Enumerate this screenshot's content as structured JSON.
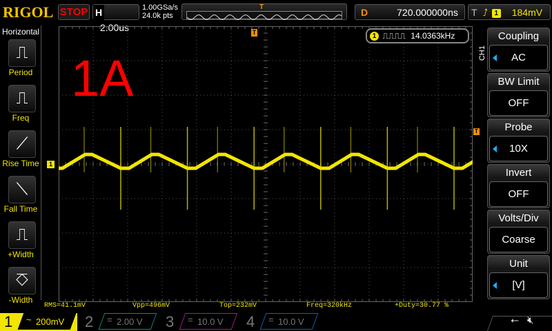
{
  "header": {
    "brand": "RIGOL",
    "run_state": "STOP",
    "h_label": "H",
    "timebase": "2.00us",
    "sample_rate": "1.00GSa/s",
    "memory_depth": "24.0k pts",
    "trigger_marker": "T",
    "delay_label": "D",
    "delay": "720.000000ns",
    "trigger_label": "T",
    "trigger_source": "1",
    "trigger_level": "184mV"
  },
  "left_menu": {
    "title": "Horizontal",
    "items": [
      {
        "label": "Period"
      },
      {
        "label": "Freq"
      },
      {
        "label": "Rise Time"
      },
      {
        "label": "Fall Time"
      },
      {
        "label": "+Width"
      },
      {
        "label": "-Width"
      }
    ]
  },
  "screen": {
    "overlay_text": "1A",
    "freq_counter": "14.0363kHz",
    "ch_marker": "1",
    "trig_pos_marker": "T",
    "trig_level_marker": "T"
  },
  "right_menu": {
    "channel": "CH1",
    "items": [
      {
        "title": "Coupling",
        "value": "AC"
      },
      {
        "title": "BW Limit",
        "value": "OFF"
      },
      {
        "title": "Probe",
        "value": "10X"
      },
      {
        "title": "Invert",
        "value": "OFF"
      },
      {
        "title": "Volts/Div",
        "value": "Coarse"
      },
      {
        "title": "Unit",
        "value": "[V]"
      }
    ]
  },
  "measurements": [
    "RMS=41.1mV",
    "Vpp=496mV",
    "Top=232mV",
    "Freq=320kHz",
    "+Duty=30.77 %"
  ],
  "channels": [
    {
      "num": "1",
      "coupling": "~",
      "scale": "200mV",
      "color": "#f2e600"
    },
    {
      "num": "2",
      "coupling": "=",
      "scale": "2.00 V",
      "color": "#0d8a7a"
    },
    {
      "num": "3",
      "coupling": "=",
      "scale": "10.0 V",
      "color": "#a0208a"
    },
    {
      "num": "4",
      "coupling": "=",
      "scale": "10.0 V",
      "color": "#1060b0"
    }
  ],
  "colors": {
    "trace": "#f2e600",
    "overlay": "#ff0000",
    "accent": "#1ab0f0",
    "trigger": "#ff8c00"
  }
}
